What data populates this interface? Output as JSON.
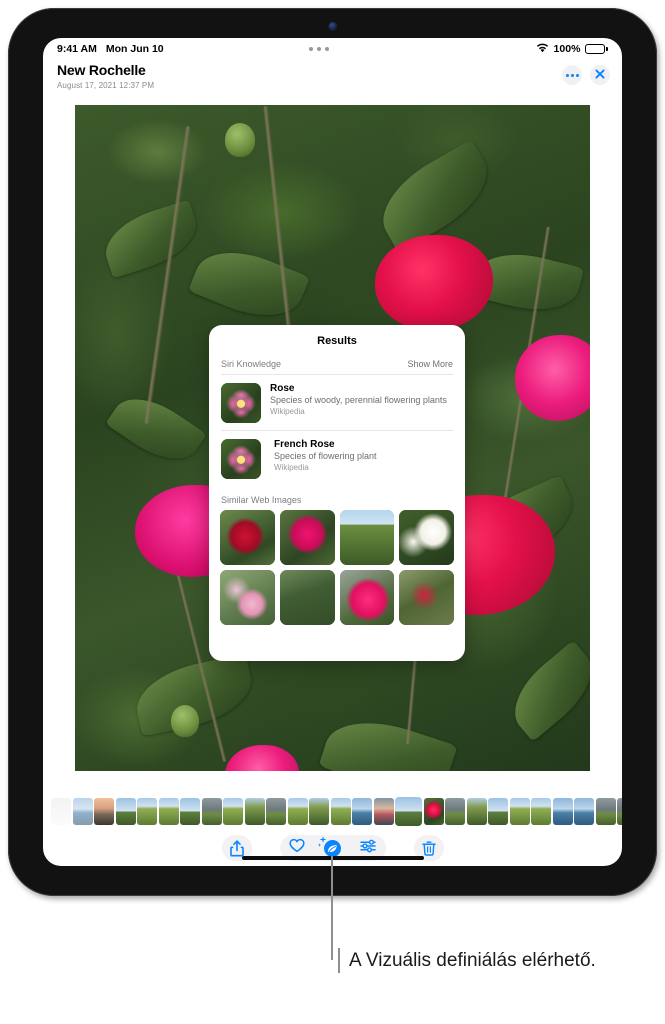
{
  "status_bar": {
    "time": "9:41 AM",
    "date": "Mon Jun 10",
    "wifi_icon": "wifi-icon",
    "battery_percent": "100%",
    "battery_icon": "battery-full-icon",
    "multitask_icon": "multitasking-dots-icon"
  },
  "header": {
    "title": "New Rochelle",
    "subtitle": "August 17, 2021  12:37 PM",
    "more_icon": "ellipsis-icon",
    "close_icon": "close-x-icon"
  },
  "photo": {
    "name": "rose-bush-photo",
    "alt": "Close-up of a rose bush with red and pink roses among green leaves"
  },
  "results_popup": {
    "title": "Results",
    "siri_knowledge_label": "Siri Knowledge",
    "show_more_label": "Show More",
    "entries": [
      {
        "name": "Rose",
        "description": "Species of woody, perennial flowering plants",
        "source": "Wikipedia",
        "thumb_icon": "pink-rose-thumbnail"
      },
      {
        "name": "French Rose",
        "description": "Species of flowering plant",
        "source": "Wikipedia",
        "thumb_icon": "french-rose-thumbnail"
      }
    ],
    "similar_label": "Similar Web Images",
    "similar_images": [
      "red-rose-closeup",
      "pink-rose-cluster",
      "rose-in-garden-with-sky",
      "white-roses",
      "pale-pink-roses",
      "green-rose-foliage",
      "bright-pink-rose-buds",
      "red-rose-shrub-with-label"
    ]
  },
  "filmstrip": {
    "name": "photo-filmstrip",
    "selected_index": 16,
    "thumbs": [
      {
        "kind": "plain",
        "fade": "fade-l"
      },
      {
        "kind": "sea",
        "fade": "fade-l2"
      },
      {
        "kind": "sunset",
        "fade": ""
      },
      {
        "kind": "sky",
        "fade": ""
      },
      {
        "kind": "field",
        "fade": ""
      },
      {
        "kind": "field",
        "fade": ""
      },
      {
        "kind": "sky",
        "fade": ""
      },
      {
        "kind": "stone",
        "fade": ""
      },
      {
        "kind": "field",
        "fade": ""
      },
      {
        "kind": "tree",
        "fade": ""
      },
      {
        "kind": "stone",
        "fade": ""
      },
      {
        "kind": "field",
        "fade": ""
      },
      {
        "kind": "tree",
        "fade": ""
      },
      {
        "kind": "field",
        "fade": ""
      },
      {
        "kind": "sea",
        "fade": ""
      },
      {
        "kind": "person",
        "fade": ""
      },
      {
        "kind": "sky",
        "fade": ""
      },
      {
        "kind": "rose",
        "fade": ""
      },
      {
        "kind": "stone",
        "fade": ""
      },
      {
        "kind": "tree",
        "fade": ""
      },
      {
        "kind": "sky",
        "fade": ""
      },
      {
        "kind": "field",
        "fade": ""
      },
      {
        "kind": "field",
        "fade": ""
      },
      {
        "kind": "sea",
        "fade": ""
      },
      {
        "kind": "sea",
        "fade": ""
      },
      {
        "kind": "stone",
        "fade": ""
      },
      {
        "kind": "stone",
        "fade": ""
      },
      {
        "kind": "door",
        "fade": ""
      },
      {
        "kind": "stone",
        "fade": ""
      },
      {
        "kind": "person",
        "fade": ""
      },
      {
        "kind": "field",
        "fade": ""
      },
      {
        "kind": "person",
        "fade": ""
      },
      {
        "kind": "rose",
        "fade": "fade-r"
      },
      {
        "kind": "plain",
        "fade": "fade-r"
      }
    ]
  },
  "toolbar": {
    "share_icon": "share-arrow-icon",
    "favorite_icon": "heart-icon",
    "visual_look_up_icon": "visual-look-up-sparkle-icon",
    "adjust_icon": "adjust-sliders-icon",
    "delete_icon": "trash-icon",
    "accent_color": "#0a84ff",
    "home_indicator": "home-indicator"
  },
  "callout": {
    "text": "A Vizuális definiálás elérhető.",
    "line_color": "#8e8e93"
  }
}
